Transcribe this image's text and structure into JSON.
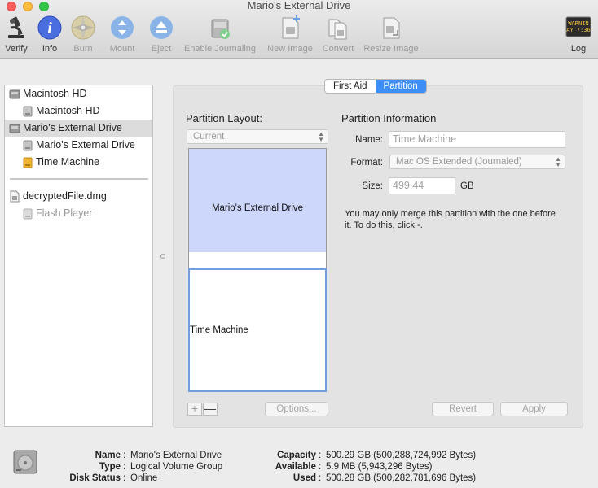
{
  "window": {
    "title": "Mario's External Drive"
  },
  "toolbar": {
    "items": [
      {
        "id": "verify",
        "label": "Verify",
        "icon": "microscope-icon",
        "enabled": true
      },
      {
        "id": "info",
        "label": "Info",
        "icon": "info-icon",
        "enabled": true
      },
      {
        "id": "burn",
        "label": "Burn",
        "icon": "burn-disc-icon",
        "enabled": false
      },
      {
        "id": "mount",
        "label": "Mount",
        "icon": "mount-icon",
        "enabled": false
      },
      {
        "id": "eject",
        "label": "Eject",
        "icon": "eject-icon",
        "enabled": false
      },
      {
        "id": "enable-journaling",
        "label": "Enable Journaling",
        "icon": "journaling-disk-icon",
        "enabled": false
      },
      {
        "id": "new-image",
        "label": "New Image",
        "icon": "new-image-icon",
        "enabled": false
      },
      {
        "id": "convert",
        "label": "Convert",
        "icon": "convert-icon",
        "enabled": false
      },
      {
        "id": "resize-image",
        "label": "Resize Image",
        "icon": "resize-image-icon",
        "enabled": false
      },
      {
        "id": "log",
        "label": "Log",
        "icon": "log-console-icon",
        "enabled": true,
        "icon_text": [
          "WARNIN",
          "AY 7:36"
        ]
      }
    ]
  },
  "sidebar": {
    "items": [
      {
        "label": "Macintosh HD",
        "icon": "hard-drive-icon",
        "level": 0,
        "selected": false,
        "dim": false
      },
      {
        "label": "Macintosh HD",
        "icon": "volume-icon",
        "level": 1,
        "selected": false,
        "dim": false
      },
      {
        "label": "Mario's External Drive",
        "icon": "hard-drive-icon",
        "level": 0,
        "selected": true,
        "dim": false
      },
      {
        "label": "Mario's External Drive",
        "icon": "volume-icon",
        "level": 1,
        "selected": false,
        "dim": false
      },
      {
        "label": "Time Machine",
        "icon": "time-machine-volume-icon",
        "level": 1,
        "selected": false,
        "dim": false
      }
    ],
    "images": [
      {
        "label": "decryptedFile.dmg",
        "icon": "disk-image-icon",
        "level": 0,
        "dim": false
      },
      {
        "label": "Flash Player",
        "icon": "volume-icon",
        "level": 1,
        "dim": true
      }
    ]
  },
  "tabs": {
    "items": [
      "First Aid",
      "Partition"
    ],
    "active": "Partition"
  },
  "partition_layout": {
    "heading": "Partition Layout:",
    "popup_value": "Current",
    "partitions": [
      {
        "name": "Mario's External Drive",
        "color": "#cdd6fb",
        "selected": false
      },
      {
        "name": "Time Machine",
        "color": "#ffffff",
        "selected": true
      }
    ],
    "add_label": "+",
    "remove_label": "—",
    "options_label": "Options..."
  },
  "partition_info": {
    "heading": "Partition Information",
    "name_label": "Name:",
    "name_value": "Time Machine",
    "format_label": "Format:",
    "format_value": "Mac OS Extended (Journaled)",
    "size_label": "Size:",
    "size_value": "499.44",
    "size_unit": "GB",
    "note": "You may only merge this partition with the one before it. To do this, click -."
  },
  "actions": {
    "revert": "Revert",
    "apply": "Apply"
  },
  "footer": {
    "left": [
      {
        "key": "Name",
        "value": "Mario's External Drive"
      },
      {
        "key": "Type",
        "value": "Logical Volume Group"
      },
      {
        "key": "Disk Status",
        "value": "Online"
      }
    ],
    "right": [
      {
        "key": "Capacity",
        "value": "500.29 GB (500,288,724,992 Bytes)"
      },
      {
        "key": "Available",
        "value": "5.9 MB (5,943,296 Bytes)"
      },
      {
        "key": "Used",
        "value": "500.28 GB (500,282,781,696 Bytes)"
      }
    ]
  }
}
